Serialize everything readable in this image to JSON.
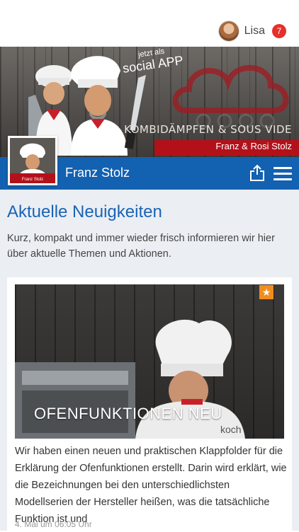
{
  "user": {
    "name": "Lisa",
    "notifications": "7"
  },
  "banner": {
    "tagline_small": "jetzt als",
    "tagline_big": "social APP",
    "brand_line1": "KOMBIDÄMPFEN & SOUS VIDE",
    "brand_line2": "Franz & Rosi Stolz",
    "thumb_caption": "Franz Stolz"
  },
  "profile": {
    "name": "Franz Stolz",
    "share_icon": "share-icon",
    "menu_icon": "menu-icon"
  },
  "section": {
    "title": "Aktuelle Neuigkeiten",
    "intro": "Kurz, kompakt und immer wieder frisch informieren wir hier über aktuelle Themen und Aktionen."
  },
  "post": {
    "title": "OFENFUNKTIONEN NEU",
    "text": "Wir haben einen neuen und praktischen Klappfolder für die Erklärung der Ofenfunktionen erstellt. Darin wird erklärt, wie die Bezeichnungen bei den unterschiedlichsten Modellserien der Hersteller heißen, was die tatsächliche Funktion ist und",
    "date": "4. Mai um 06:05 Uhr",
    "image_watermark": "koch",
    "star_icon": "star-icon"
  },
  "colors": {
    "nav_blue": "#1361b1",
    "heading_blue": "#1a64b5",
    "badge_red": "#e5302b",
    "star_orange": "#f08d1e",
    "brand_red": "#b3111a"
  }
}
